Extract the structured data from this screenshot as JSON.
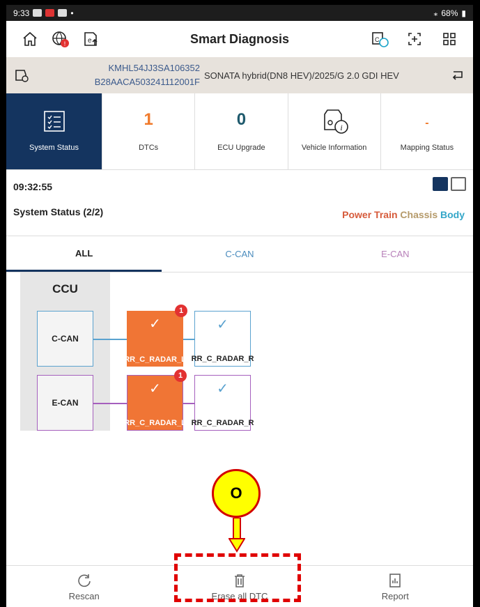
{
  "status_bar": {
    "time": "9:33",
    "battery": "68%"
  },
  "app_bar": {
    "title": "Smart Diagnosis",
    "left_icons": [
      "home-icon",
      "globe-alert-icon",
      "ecu-upload-icon"
    ],
    "right_icons": [
      "connection-status-icon",
      "scan-icon",
      "grid-menu-icon"
    ]
  },
  "vehicle": {
    "vin_line1": "KMHL54JJ3SA106352",
    "vin_line2": "B28AACA503241112001F",
    "model": "SONATA hybrid(DN8 HEV)/2025/G 2.0 GDI HEV"
  },
  "summary_tabs": [
    {
      "label": "System Status",
      "value": "",
      "icon": "system-status-icon",
      "active": true
    },
    {
      "label": "DTCs",
      "value": "1"
    },
    {
      "label": "ECU Upgrade",
      "value": "0"
    },
    {
      "label": "Vehicle Information",
      "value": "",
      "icon": "vehicle-info-icon"
    },
    {
      "label": "Mapping Status",
      "value": "-"
    }
  ],
  "info": {
    "time": "09:32:55",
    "system_status": "System Status (2/2)",
    "categories": {
      "power_train": "Power Train",
      "chassis": "Chassis",
      "body": "Body"
    }
  },
  "network_tabs": [
    "ALL",
    "C-CAN",
    "E-CAN"
  ],
  "diagram": {
    "gateway": "CCU",
    "buses": [
      "C-CAN",
      "E-CAN"
    ],
    "nodes": [
      {
        "bus": "C-CAN",
        "label": "RR_C_RADAR_L",
        "status": "fault",
        "badge": "1"
      },
      {
        "bus": "C-CAN",
        "label": "RR_C_RADAR_R",
        "status": "ok"
      },
      {
        "bus": "E-CAN",
        "label": "RR_C_RADAR_L",
        "status": "fault",
        "badge": "1"
      },
      {
        "bus": "E-CAN",
        "label": "RR_C_RADAR_R",
        "status": "ok"
      }
    ]
  },
  "callout": {
    "label": "O"
  },
  "bottom_bar": {
    "rescan": "Rescan",
    "erase": "Erase all DTC",
    "report": "Report"
  },
  "colors": {
    "accent": "#14345f",
    "fault": "#f07535",
    "c_can": "#5aa2cf",
    "e_can": "#a55fbd",
    "highlight": "#e00000"
  }
}
